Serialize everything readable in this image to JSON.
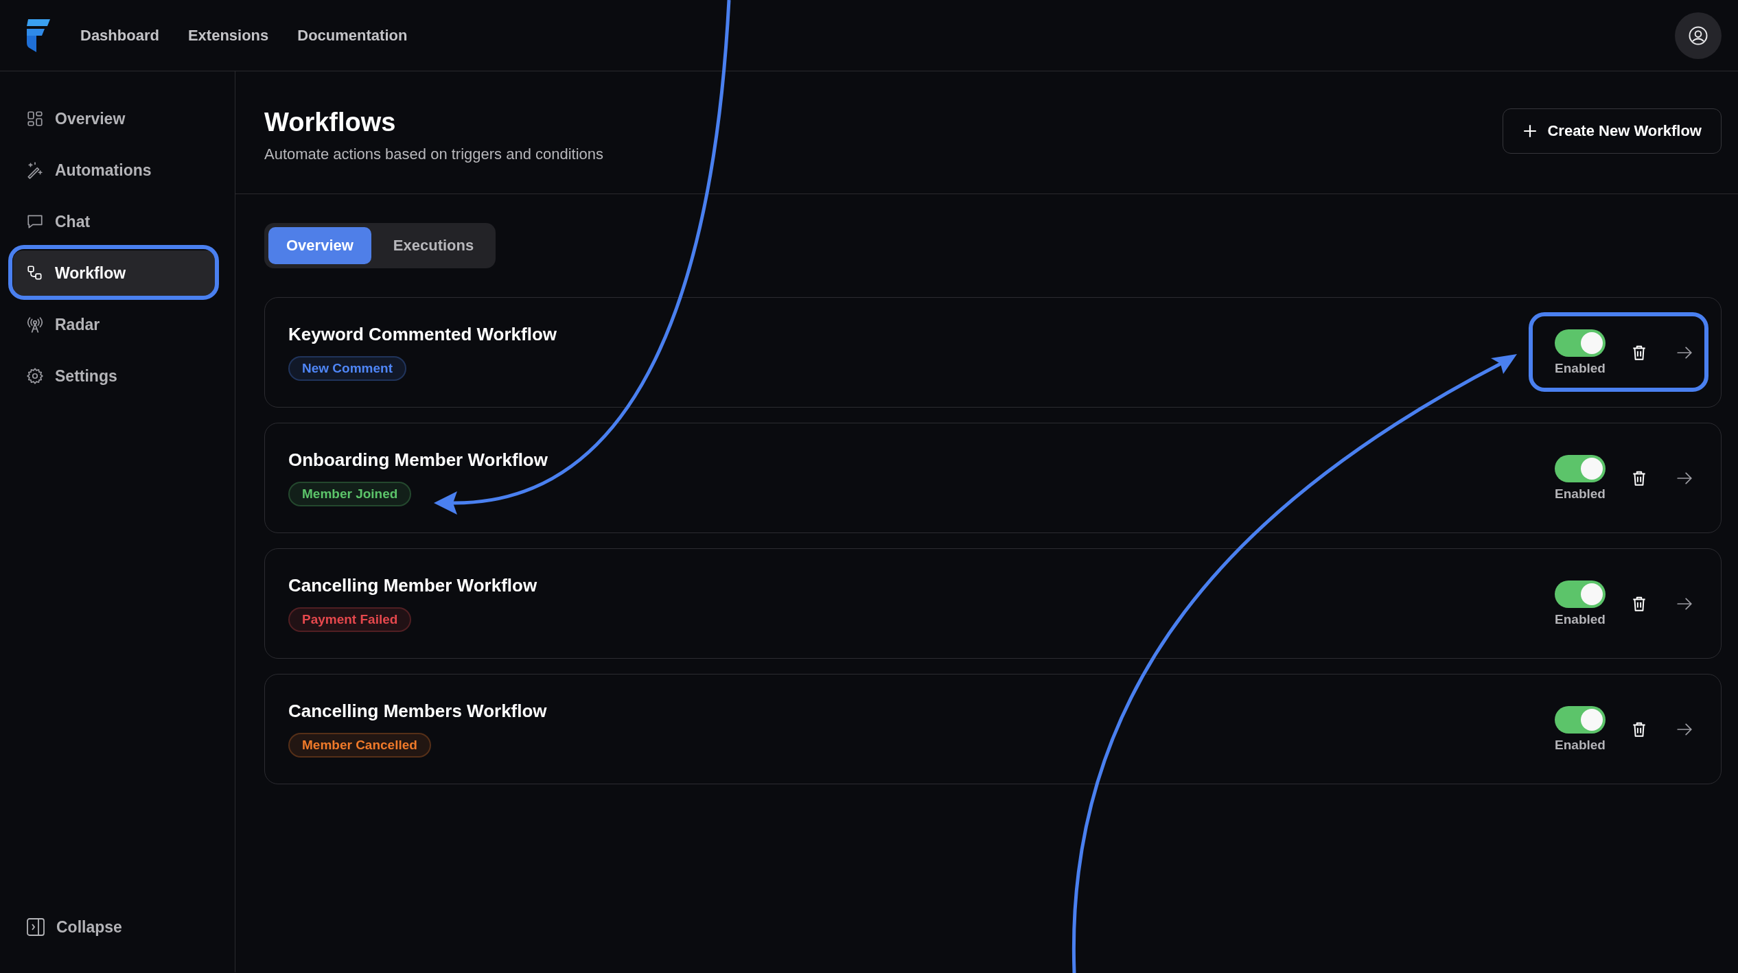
{
  "top_nav": {
    "links": [
      {
        "label": "Dashboard"
      },
      {
        "label": "Extensions"
      },
      {
        "label": "Documentation"
      }
    ]
  },
  "sidebar": {
    "items": [
      {
        "label": "Overview",
        "selected": false
      },
      {
        "label": "Automations",
        "selected": false
      },
      {
        "label": "Chat",
        "selected": false
      },
      {
        "label": "Workflow",
        "selected": true
      },
      {
        "label": "Radar",
        "selected": false
      },
      {
        "label": "Settings",
        "selected": false
      }
    ],
    "collapse": "Collapse"
  },
  "header": {
    "title": "Workflows",
    "subtitle": "Automate actions based on triggers and conditions",
    "create_button": "Create New Workflow"
  },
  "tabs": [
    {
      "label": "Overview",
      "selected": true
    },
    {
      "label": "Executions",
      "selected": false
    }
  ],
  "workflows": [
    {
      "name": "Keyword Commented Workflow",
      "tag": "New Comment",
      "color": "#4f86f7",
      "on": true,
      "status": "Enabled"
    },
    {
      "name": "Onboarding Member Workflow",
      "tag": "Member Joined",
      "color": "#5cc46a",
      "on": true,
      "status": "Enabled"
    },
    {
      "name": "Cancelling Member Workflow",
      "tag": "Payment Failed",
      "color": "#e5484d",
      "on": true,
      "status": "Enabled"
    },
    {
      "name": "Cancelling Members Workflow",
      "tag": "Member Cancelled",
      "color": "#f07a2a",
      "on": true,
      "status": "Enabled"
    }
  ]
}
